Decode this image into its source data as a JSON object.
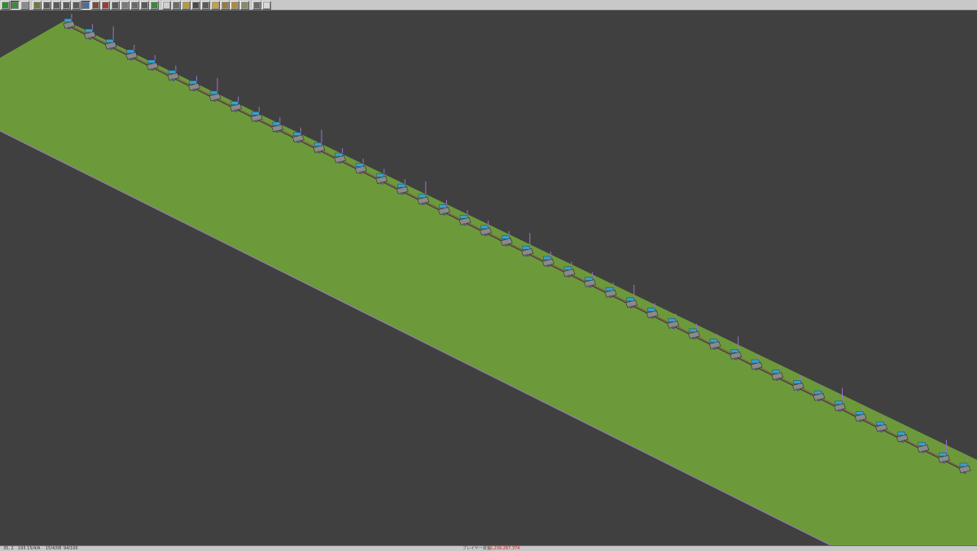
{
  "toolbar": {
    "buttons": [
      {
        "name": "main-menu-button",
        "color": "#2f8f2f"
      },
      {
        "name": "minimap-button",
        "color": "#3c8a3c",
        "active": true
      },
      {
        "name": "info-tool-button",
        "color": "#8a8a8a"
      },
      {
        "name": "terrain-slope-button",
        "color": "#6a7c3a"
      },
      {
        "name": "rail-tools-button",
        "color": "#5a5a5a"
      },
      {
        "name": "monorail-tools-button",
        "color": "#5a5a5a"
      },
      {
        "name": "maglev-tools-button",
        "color": "#5a5a5a"
      },
      {
        "name": "narrow-gauge-tools-button",
        "color": "#5a5a5a"
      },
      {
        "name": "road-tools-button",
        "color": "#4a6ea0",
        "active": true
      },
      {
        "name": "tram-tools-button",
        "color": "#7a4a3a"
      },
      {
        "name": "ship-tools-button",
        "color": "#a03a3a"
      },
      {
        "name": "air-tools-button",
        "color": "#5a5a5a"
      },
      {
        "name": "signal-tools-button",
        "color": "#7a7a7a"
      },
      {
        "name": "station-tools-button",
        "color": "#6a6a6a"
      },
      {
        "name": "depot-tools-button",
        "color": "#5a5a5a"
      },
      {
        "name": "landscape-tools-button",
        "color": "#3a8a3a"
      },
      {
        "name": "special-tools-button",
        "color": "#d0d0d0"
      },
      {
        "name": "wayobj-tools-button",
        "color": "#6a6a6a"
      },
      {
        "name": "list-halts-button",
        "color": "#b89a3a"
      },
      {
        "name": "line-management-button",
        "color": "#4a4a4a"
      },
      {
        "name": "convoy-list-button",
        "color": "#5a5a5a"
      },
      {
        "name": "finance-button",
        "color": "#c8a23a"
      },
      {
        "name": "factory-list-button",
        "color": "#9a7a3a"
      },
      {
        "name": "city-list-button",
        "color": "#b08a3a"
      },
      {
        "name": "messages-button",
        "color": "#8a8a6a"
      },
      {
        "name": "zoom-button",
        "color": "#6a6a6a"
      },
      {
        "name": "settings-button",
        "color": "#d8d8d8"
      }
    ]
  },
  "map": {
    "ground_color": "#6c9a3a",
    "ground_edge_light": "#b070e0",
    "void_color": "#404040",
    "track_color": "#7a6a4a",
    "station_count": 44
  },
  "status": {
    "coords": "35, 2",
    "date": "193 15/4/A",
    "speed": "15/4/08",
    "fps": "94/100",
    "money_label": "プレイヤー資金",
    "money": "-2,239,287,374"
  }
}
